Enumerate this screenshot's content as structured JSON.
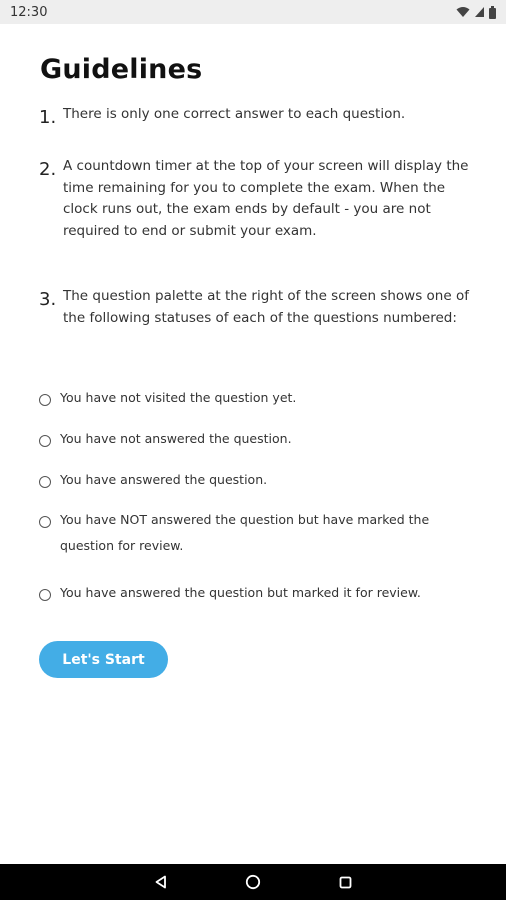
{
  "status_bar": {
    "time": "12:30",
    "icons": [
      "wifi-icon",
      "signal-icon",
      "battery-icon"
    ]
  },
  "page": {
    "title": "Guidelines"
  },
  "guidelines": [
    {
      "number": "1.",
      "text": "There is only one correct answer to each question."
    },
    {
      "number": "2.",
      "text": "A countdown timer at the top of your screen will display the time remaining for you to complete the exam. When the clock runs out, the exam ends by default - you are not required to end or submit your exam."
    },
    {
      "number": "3.",
      "text": "The question palette at the right of the screen shows one of the following statuses of each of the questions numbered:"
    }
  ],
  "statuses": [
    {
      "label": "You have not visited the question yet."
    },
    {
      "label": "You have not answered the question."
    },
    {
      "label": "You have answered the question."
    },
    {
      "label": "You have NOT answered the question but have marked the question for review."
    },
    {
      "label": "You have answered the question but marked it for review."
    }
  ],
  "start_button": {
    "label": "Let's Start"
  },
  "colors": {
    "accent": "#43ade6",
    "status_bar": "#eeeeee",
    "nav_bar": "#000000"
  },
  "nav_bar": {
    "icons": [
      "back-icon",
      "home-icon",
      "recents-icon"
    ]
  }
}
